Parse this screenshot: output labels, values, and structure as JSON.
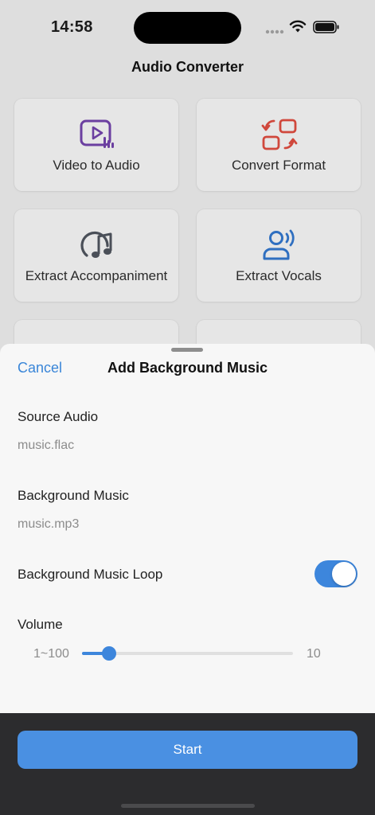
{
  "status_bar": {
    "time": "14:58"
  },
  "app": {
    "title": "Audio Converter"
  },
  "tiles": [
    {
      "label": "Video to Audio",
      "icon": "video-to-audio-icon",
      "color": "#6b3fa0"
    },
    {
      "label": "Convert Format",
      "icon": "convert-format-icon",
      "color": "#d0483c"
    },
    {
      "label": "Extract Accompaniment",
      "icon": "music-note-icon",
      "color": "#4a4f58"
    },
    {
      "label": "Extract Vocals",
      "icon": "vocals-icon",
      "color": "#2f6fc0"
    }
  ],
  "sheet": {
    "cancel_label": "Cancel",
    "title": "Add Background Music",
    "source_audio": {
      "label": "Source Audio",
      "value": "music.flac"
    },
    "background_music": {
      "label": "Background Music",
      "value": "music.mp3"
    },
    "loop": {
      "label": "Background Music Loop",
      "enabled": true
    },
    "volume": {
      "label": "Volume",
      "range_text": "1~100",
      "value": "10",
      "min": 1,
      "max": 100,
      "current": 10
    }
  },
  "bottom": {
    "start_label": "Start"
  },
  "colors": {
    "accent": "#3d86dc",
    "start_button": "#4a90e2",
    "bottom_bar": "#2c2c2e"
  }
}
